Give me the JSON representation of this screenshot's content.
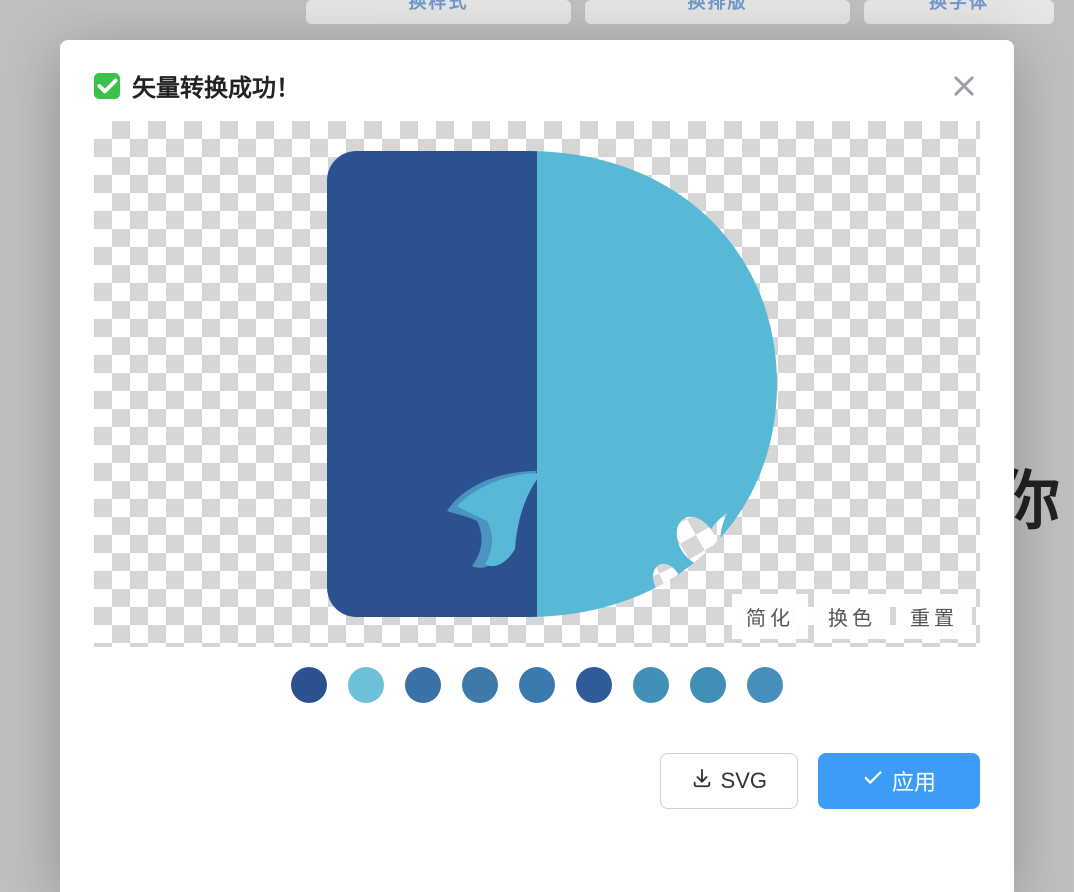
{
  "background": {
    "tabs": [
      "换样式",
      "换排版",
      "换字体"
    ],
    "bg_text_fragment": "你"
  },
  "modal": {
    "title": "矢量转换成功！",
    "preview": {
      "controls": {
        "simplify": "简化",
        "recolor": "换色",
        "reset": "重置"
      },
      "logo_colors": {
        "left": "#2b5190",
        "right": "#57b9d6",
        "tail_highlight": "#4a9cc5"
      }
    },
    "swatches": [
      "#2b5190",
      "#6cc1d8",
      "#3b71a6",
      "#3d7aab",
      "#3a7aaf",
      "#2f5b9a",
      "#4190b8",
      "#3f8fb6",
      "#468fbd"
    ],
    "actions": {
      "download_svg": "SVG",
      "apply": "应用"
    }
  }
}
